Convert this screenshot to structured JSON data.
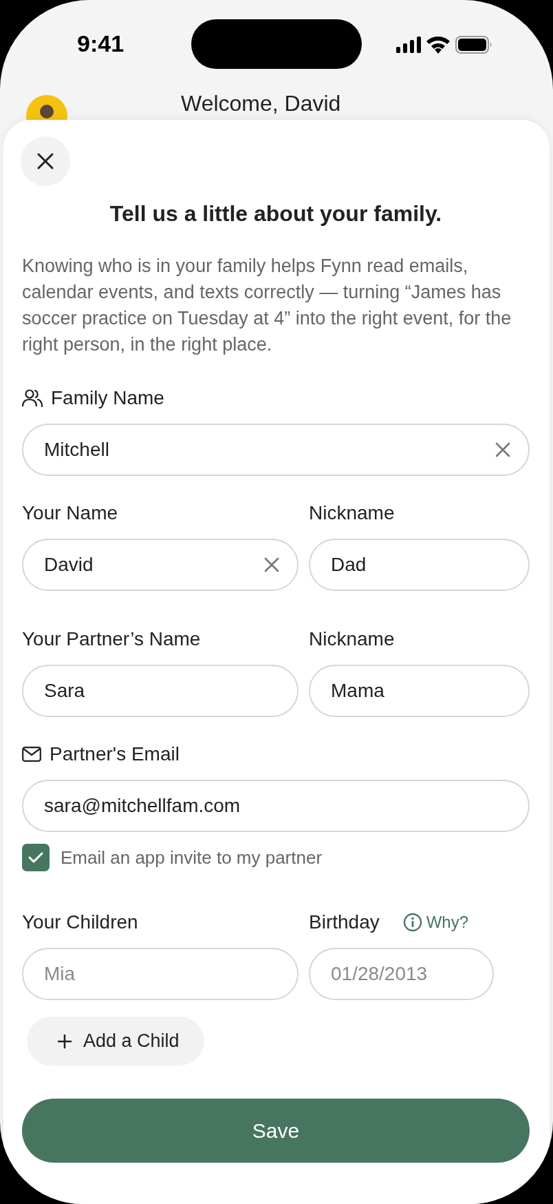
{
  "status_bar": {
    "time": "9:41"
  },
  "header": {
    "title": "Welcome, David"
  },
  "sheet": {
    "title": "Tell us a little about your family.",
    "intro": "Knowing who is in your family helps Fynn read emails, calendar events, and texts correctly — turning “James has soccer practice on Tuesday at 4” into the right event, for the right person, in the right place."
  },
  "family_name": {
    "label": "Family Name",
    "value": "Mitchell",
    "clearable": true
  },
  "you": {
    "name": {
      "label": "Your Name",
      "value": "David",
      "clearable": true
    },
    "nickname": {
      "label": "Nickname",
      "value": "Dad",
      "clearable": false
    }
  },
  "partner": {
    "name": {
      "label": "Your Partner’s Name",
      "value": "Sara",
      "clearable": false
    },
    "nickname": {
      "label": "Nickname",
      "value": "Mama",
      "clearable": false
    }
  },
  "partner_email": {
    "label": "Partner's Email",
    "value": "sara@mitchellfam.com"
  },
  "invite": {
    "label": "Email an app invite to my partner",
    "checked": true
  },
  "children": {
    "label": "Your Children",
    "birthday_label": "Birthday",
    "why_link": "Why?",
    "rows": [
      {
        "name_placeholder": "Mia",
        "birthday_placeholder": "01/28/2013"
      }
    ],
    "add_button": "Add a Child"
  },
  "save_button": "Save"
}
